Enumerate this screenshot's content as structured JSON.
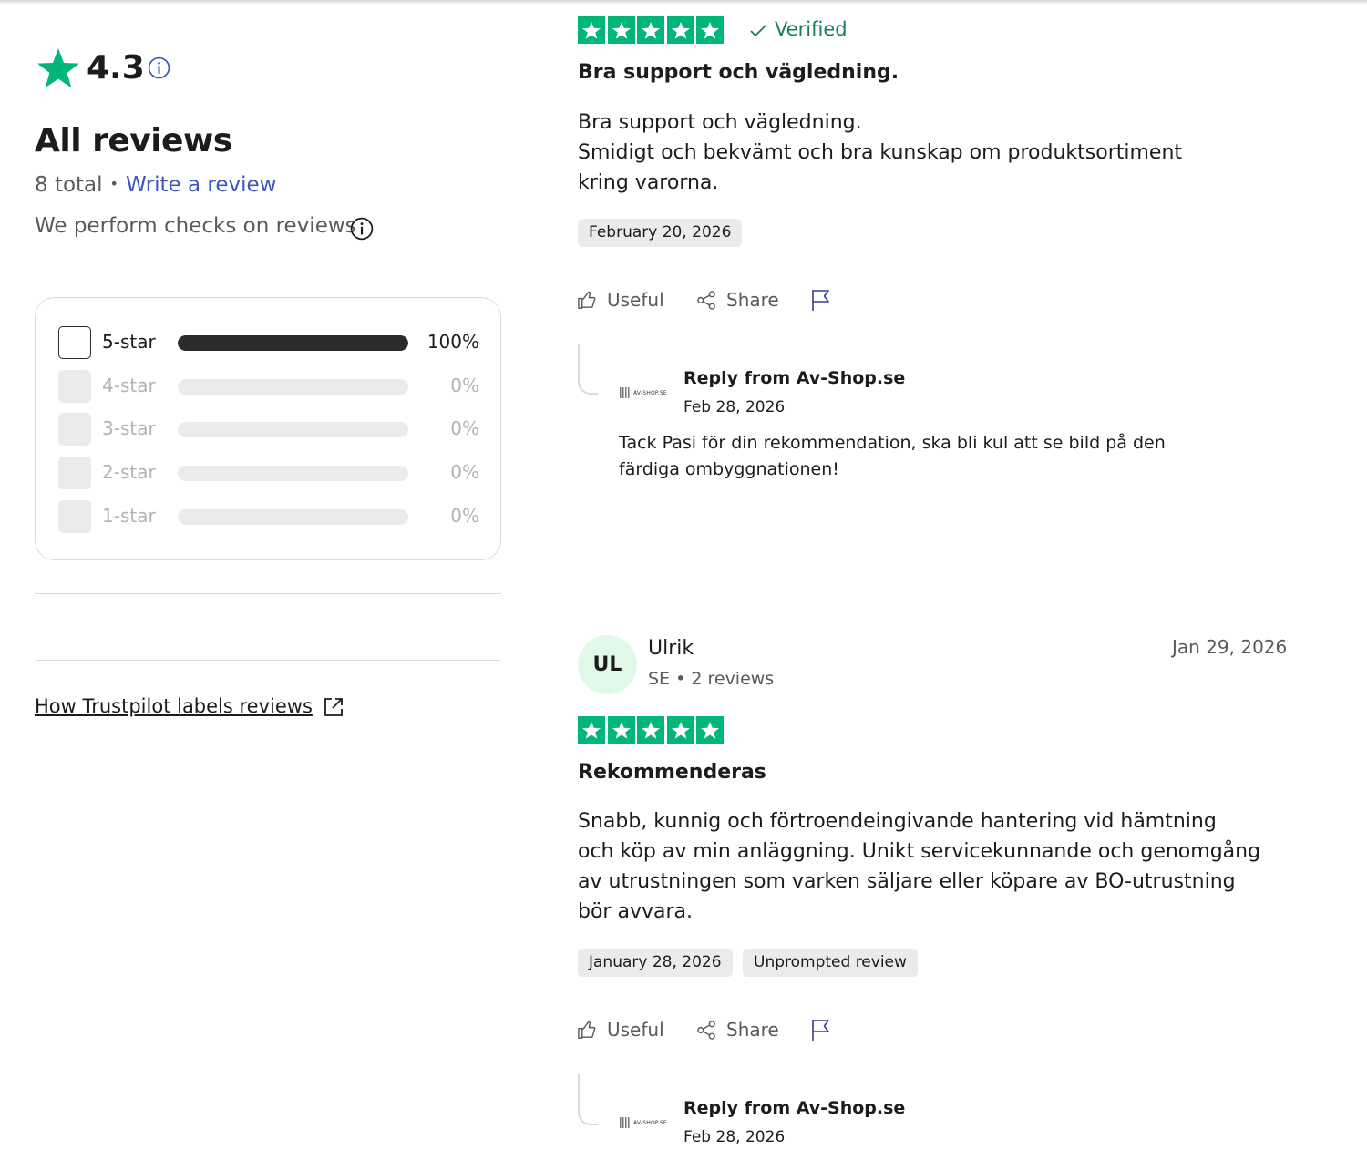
{
  "summary": {
    "rating": "4.3",
    "title": "All reviews",
    "total": "8 total",
    "write_review": "Write a review",
    "checks": "We perform checks on reviews",
    "star_color": "#00b67a",
    "link_color": "#3c57bc"
  },
  "distribution": [
    {
      "label": "5-star",
      "percent": "100%",
      "fill": 1.0,
      "selected": true
    },
    {
      "label": "4-star",
      "percent": "0%",
      "fill": 0,
      "selected": false
    },
    {
      "label": "3-star",
      "percent": "0%",
      "fill": 0,
      "selected": false
    },
    {
      "label": "2-star",
      "percent": "0%",
      "fill": 0,
      "selected": false
    },
    {
      "label": "1-star",
      "percent": "0%",
      "fill": 0,
      "selected": false
    }
  ],
  "labels_link": "How Trustpilot labels reviews",
  "reviews": [
    {
      "stars": 5,
      "verified": "Verified",
      "title": "Bra support och vägledning.",
      "body": [
        "Bra support och vägledning.",
        "Smidigt och bekvämt och bra kunskap om produktsortiment",
        "kring varorna."
      ],
      "date_chip": "February 20, 2026",
      "actions": {
        "useful": "Useful",
        "share": "Share",
        "report": "flag-icon"
      },
      "reply": {
        "logo_text": "AV-SHOP.SE",
        "from": "Reply from Av-Shop.se",
        "date": "Feb 28, 2026",
        "body": [
          "Tack Pasi för din rekommendation, ska bli kul att se bild på den",
          "färdiga ombyggnationen!"
        ]
      }
    },
    {
      "initials": "UL",
      "name": "Ulrik",
      "meta": "SE • 2 reviews",
      "date": "Jan 29, 2026",
      "stars": 5,
      "title": "Rekommenderas",
      "body": [
        "Snabb, kunnig och förtroendeingivande hantering vid hämtning",
        "och köp av min anläggning. Unikt servicekunnande och genomgång",
        "av utrustningen som varken säljare eller köpare av BO-utrustning",
        "bör avvara."
      ],
      "date_chip": "January 28, 2026",
      "label_chip": "Unprompted review",
      "actions": {
        "useful": "Useful",
        "share": "Share",
        "report": "flag-icon"
      },
      "reply": {
        "logo_text": "AV-SHOP.SE",
        "from": "Reply from Av-Shop.se",
        "date": "Feb 28, 2026"
      }
    }
  ]
}
